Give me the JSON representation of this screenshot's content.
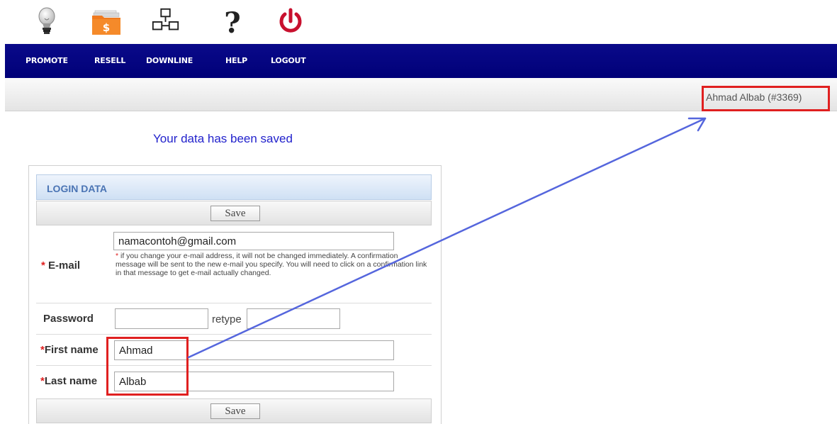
{
  "toolbar_icons": [
    {
      "name": "lightbulb-icon"
    },
    {
      "name": "dollar-folder-icon"
    },
    {
      "name": "network-icon"
    },
    {
      "name": "question-icon"
    },
    {
      "name": "power-icon"
    }
  ],
  "nav": {
    "items": [
      "PROMOTE",
      "RESELL",
      "DOWNLINE",
      "HELP",
      "LOGOUT"
    ]
  },
  "user": {
    "display": "Ahmad Albab (#3369)"
  },
  "message": {
    "saved": "Your data has been saved"
  },
  "form": {
    "section_title": "LOGIN DATA",
    "save_label": "Save",
    "email_label": "E-mail",
    "email_value": "namacontoh@gmail.com",
    "email_note": "if you change your e-mail address, it will not be changed immediately. A confirmation message will be sent to the new e-mail you specify. You will need to click on a confirmation link in that message to get e-mail actually changed.",
    "password_label": "Password",
    "retype_label": "retype",
    "first_name_label": "First name",
    "first_name_value": "Ahmad",
    "last_name_label": "Last name",
    "last_name_value": "Albab"
  },
  "colors": {
    "nav_bg": "#000080",
    "message": "#2222cc",
    "required": "#e02020",
    "annotation": "#e02020",
    "arrow": "#5566dd",
    "section_title": "#4a74b4"
  }
}
